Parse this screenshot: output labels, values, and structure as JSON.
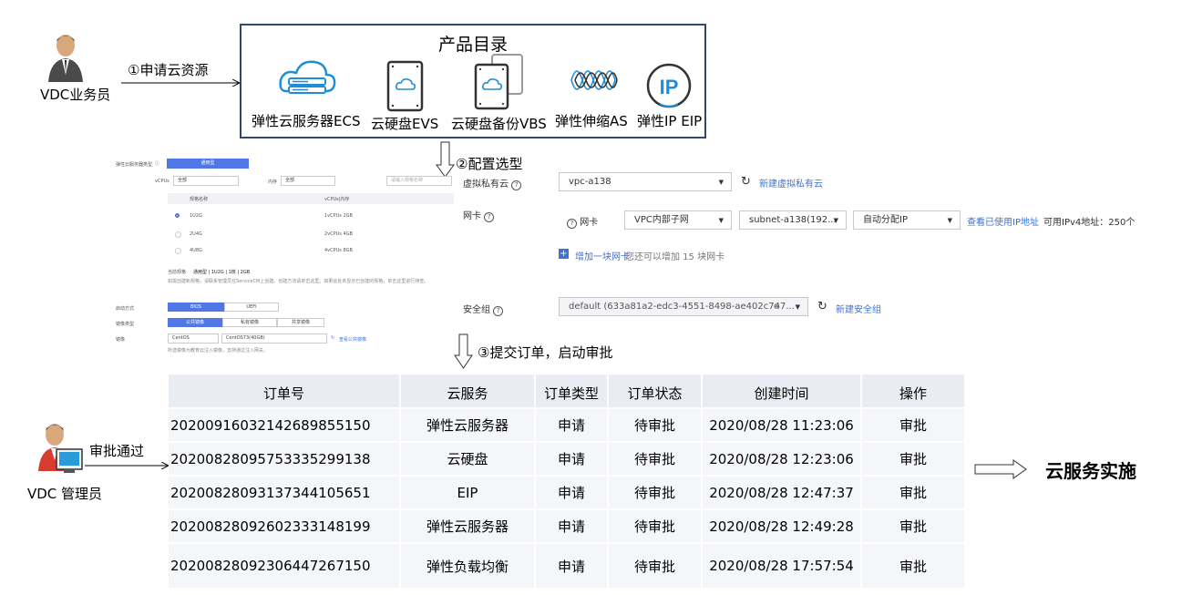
{
  "actors": {
    "clerk": "VDC业务员",
    "admin": "VDC 管理员"
  },
  "steps": {
    "step1": "①申请云资源",
    "step2": "②配置选型",
    "step3": "③提交订单，启动审批",
    "approve": "审批通过"
  },
  "catalog": {
    "title": "产品目录",
    "products": [
      {
        "label": "弹性云服务器ECS",
        "icon": "cloud-server-icon"
      },
      {
        "label": "云硬盘EVS",
        "icon": "cloud-disk-icon"
      },
      {
        "label": "云硬盘备份VBS",
        "icon": "disk-backup-icon"
      },
      {
        "label": "弹性伸缩AS",
        "icon": "auto-scaling-icon"
      },
      {
        "label": "弹性IP EIP",
        "icon": "eip-icon"
      }
    ]
  },
  "ecs_config": {
    "type_label": "弹性云服务器类型",
    "type_value": "通用型",
    "vcpus_label": "vCPUs",
    "vcpus_value": "全部",
    "mem_label": "内存",
    "mem_value": "全部",
    "search_placeholder": "请输入规格名称",
    "table_headers": [
      "规格名称",
      "vCPUs|内存"
    ],
    "rows": [
      {
        "name": "1U2G",
        "spec": "1vCPUs 2GB"
      },
      {
        "name": "2U4G",
        "spec": "2vCPUs 4GB"
      },
      {
        "name": "4U8G",
        "spec": "4vCPUs 8GB"
      }
    ],
    "current_label": "当前规格",
    "current_value": "通用型 | 1U2G | 1核 | 2GB",
    "note": "如需创建新规格，请联系管理员在ServiceCM上创建。创建方法请单击这里。如果此处未显示已创建的规格，单击这里进行排查。",
    "boot_label": "启动方式",
    "boot_options": [
      "BIOS",
      "UEFI"
    ],
    "image_type_label": "镜像类型",
    "image_type_options": [
      "公共镜像",
      "私有镜像",
      "共享镜像"
    ],
    "image_label": "镜像",
    "image_os": "CentOS",
    "image_version": "CentOS73(40GB)",
    "image_link": "查看公共镜像",
    "image_note": "所选镜像为教育云注入镜像，支持通过注入网关。"
  },
  "vpc_config": {
    "vpc_label": "虚拟私有云",
    "vpc_value": "vpc-a138",
    "vpc_link": "新建虚拟私有云",
    "nic_label": "网卡",
    "nic_inner_label": "网卡",
    "nic_subnet_type": "VPC内部子网",
    "nic_subnet": "subnet-a138(192...",
    "nic_ip": "自动分配IP",
    "nic_link": "查看已使用IP地址",
    "nic_avail": "可用IPv4地址：250个",
    "add_nic": "增加一块网卡",
    "add_nic_hint": "您还可以增加 15 块网卡",
    "sg_label": "安全组",
    "sg_value": "default (633a81a2-edc3-4551-8498-ae402c747...",
    "sg_link": "新建安全组"
  },
  "orders": {
    "headers": [
      "订单号",
      "云服务",
      "订单类型",
      "订单状态",
      "创建时间",
      "操作"
    ],
    "rows": [
      [
        "20200916032142689855150",
        "弹性云服务器",
        "申请",
        "待审批",
        "2020/08/28 11:23:06",
        "审批"
      ],
      [
        "2020082809575333529913​8",
        "云硬盘",
        "申请",
        "待审批",
        "2020/08/28 12:23:06",
        "审批"
      ],
      [
        "20200828093137344105651",
        "EIP",
        "申请",
        "待审批",
        "2020/08/28 12:47:37",
        "审批"
      ],
      [
        "20200828092602333148199",
        "弹性云服务器",
        "申请",
        "待审批",
        "2020/08/28 12:49:28",
        "审批"
      ],
      [
        "20200828092306447267150",
        "弹性负载均衡",
        "申请",
        "待审批",
        "2020/08/28 17:57:54",
        "审批"
      ]
    ]
  },
  "result": "云服务实施",
  "colors": {
    "accent": "#4f78e6",
    "link": "#3b73d6",
    "catalog_border": "#2e4a6a",
    "icon_blue": "#1e8fd6",
    "table_header_bg": "#e9ecf2",
    "table_row_bg": "#f4f6fa"
  }
}
